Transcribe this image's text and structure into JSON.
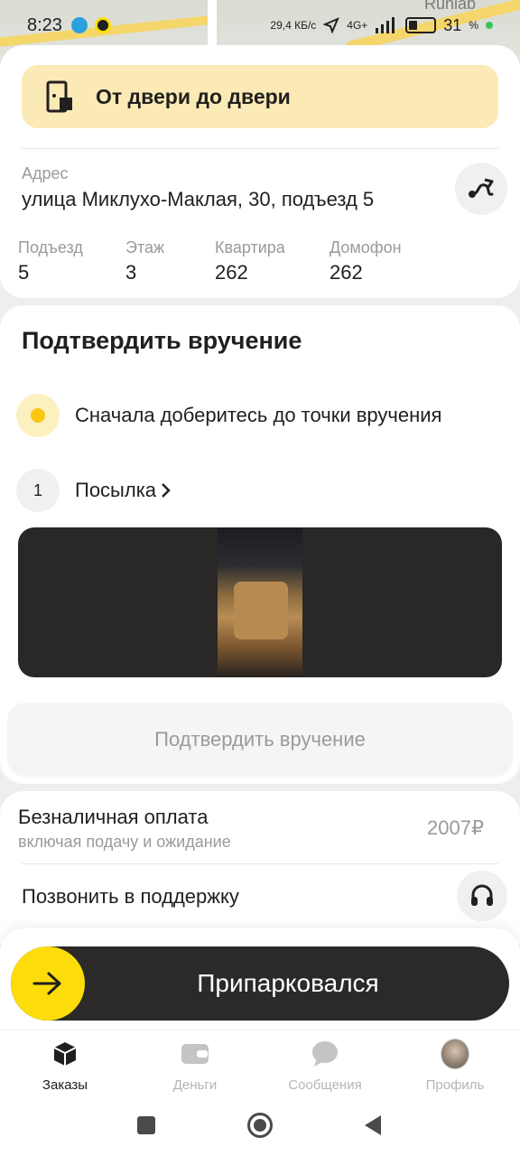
{
  "status_bar": {
    "time": "8:23",
    "network_speed": "29,4 КБ/с",
    "network_type": "4G+",
    "battery": "31",
    "battery_unit": "%"
  },
  "map": {
    "label_top_right": "Runlab"
  },
  "door_to_door": {
    "label": "От двери до двери",
    "icon": "door-box-icon"
  },
  "address": {
    "label": "Адрес",
    "value": "улица Миклухо-Маклая, 30, подъезд 5"
  },
  "details": [
    {
      "label": "Подъезд",
      "value": "5"
    },
    {
      "label": "Этаж",
      "value": "3"
    },
    {
      "label": "Квартира",
      "value": "262"
    },
    {
      "label": "Домофон",
      "value": "262"
    }
  ],
  "confirm": {
    "title": "Подтвердить вручение",
    "step_hint": "Сначала доберитесь до точки вручения",
    "parcel_count": "1",
    "parcel_label": "Посылка",
    "button_label": "Подтвердить вручение"
  },
  "payment": {
    "title": "Безналичная оплата",
    "subtitle": "включая подачу и ожидание",
    "amount": "2007₽"
  },
  "support": {
    "label": "Позвонить в поддержку"
  },
  "slider": {
    "label": "Припарковался"
  },
  "tabs": [
    {
      "label": "Заказы",
      "active": true
    },
    {
      "label": "Деньги",
      "active": false
    },
    {
      "label": "Сообщения",
      "active": false
    },
    {
      "label": "Профиль",
      "active": false
    }
  ],
  "colors": {
    "accent_yellow": "#fcdd0b",
    "door_bg": "#fbeab5",
    "dark": "#2b2a29"
  }
}
